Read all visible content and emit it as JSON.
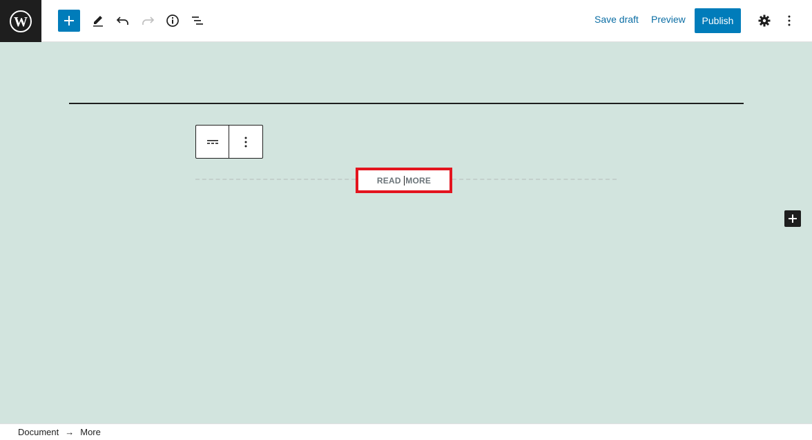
{
  "header": {
    "logo_icon": "wordpress-logo-icon",
    "tools": [
      {
        "name": "add-block",
        "icon": "plus-icon"
      },
      {
        "name": "tools",
        "icon": "pencil-icon"
      },
      {
        "name": "undo",
        "icon": "undo-icon"
      },
      {
        "name": "redo",
        "icon": "redo-icon"
      },
      {
        "name": "details",
        "icon": "info-icon"
      },
      {
        "name": "outline",
        "icon": "list-view-icon"
      }
    ],
    "save_draft_label": "Save draft",
    "preview_label": "Preview",
    "publish_label": "Publish",
    "settings_icon": "gear-icon",
    "options_icon": "more-vertical-icon"
  },
  "editor": {
    "more_block": {
      "label_part1": "READ ",
      "label_part2": "MORE"
    },
    "block_toolbar": {
      "block_type_icon": "more-block-icon",
      "options_icon": "more-vertical-icon"
    },
    "side_inserter_icon": "plus-icon"
  },
  "footer": {
    "breadcrumb": [
      "Document",
      "More"
    ],
    "separator": "→"
  },
  "colors": {
    "accent": "#007cba",
    "canvas": "#d2e4de",
    "highlight": "#e3141e",
    "dark": "#1e1e1e"
  }
}
